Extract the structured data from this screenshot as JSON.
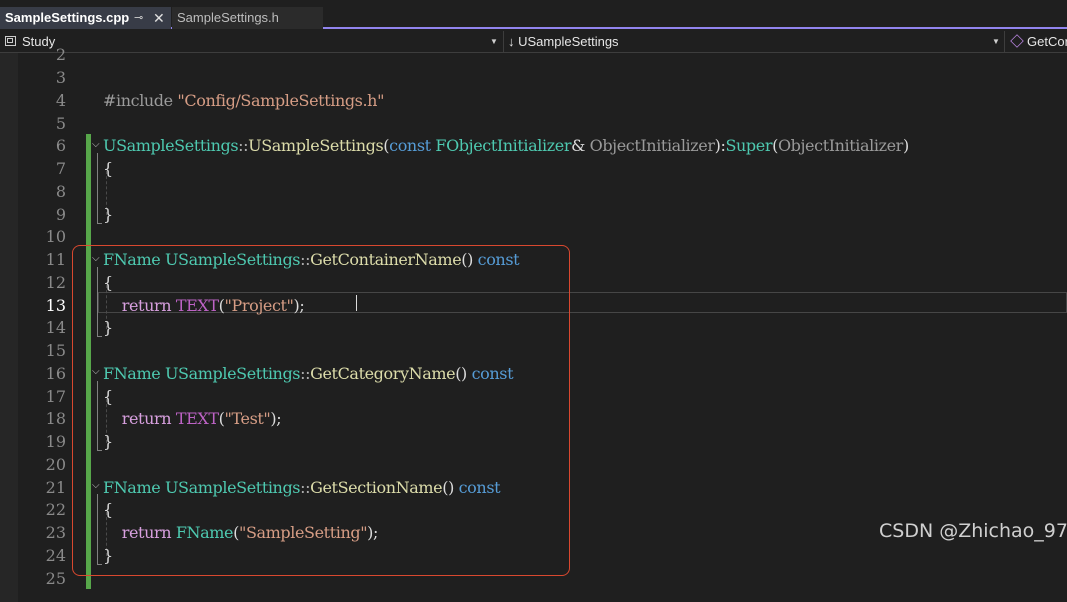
{
  "tabs": [
    {
      "label": "SampleSettings.cpp",
      "active": true
    },
    {
      "label": "SampleSettings.h",
      "active": false
    }
  ],
  "tab_icons": {
    "pin": "⊸",
    "close": "✕"
  },
  "navbar": {
    "project": "Study",
    "class_scope": "↓ USampleSettings",
    "member": "GetCor"
  },
  "editor": {
    "current_line": 13,
    "line_numbers": [
      "2",
      "3",
      "4",
      "5",
      "6",
      "7",
      "8",
      "9",
      "10",
      "11",
      "12",
      "13",
      "14",
      "15",
      "16",
      "17",
      "18",
      "19",
      "20",
      "21",
      "22",
      "23",
      "24",
      "25"
    ],
    "lines": [
      {
        "n": 4,
        "tokens": [
          [
            "pre",
            "#include "
          ],
          [
            "str",
            "\"Config/SampleSettings.h\""
          ]
        ]
      },
      {
        "n": 6,
        "tokens": [
          [
            "type",
            "USampleSettings"
          ],
          [
            "op",
            "::"
          ],
          [
            "ctor",
            "USampleSettings"
          ],
          [
            "txt",
            "("
          ],
          [
            "kw",
            "const "
          ],
          [
            "type",
            "FObjectInitializer"
          ],
          [
            "txt",
            "& "
          ],
          [
            "param",
            "ObjectInitializer"
          ],
          [
            "txt",
            "):"
          ],
          [
            "type",
            "Super"
          ],
          [
            "txt",
            "("
          ],
          [
            "param",
            "ObjectInitializer"
          ],
          [
            "txt",
            ")"
          ]
        ]
      },
      {
        "n": 7,
        "tokens": [
          [
            "txt",
            "{"
          ]
        ]
      },
      {
        "n": 9,
        "tokens": [
          [
            "txt",
            "}"
          ]
        ]
      },
      {
        "n": 11,
        "tokens": [
          [
            "type",
            "FName "
          ],
          [
            "type",
            "USampleSettings"
          ],
          [
            "op",
            "::"
          ],
          [
            "fn",
            "GetContainerName"
          ],
          [
            "txt",
            "() "
          ],
          [
            "kw",
            "const"
          ]
        ]
      },
      {
        "n": 12,
        "tokens": [
          [
            "txt",
            "{"
          ]
        ]
      },
      {
        "n": 13,
        "tokens": [
          [
            "kw-ctrl",
            "    return "
          ],
          [
            "macro",
            "TEXT"
          ],
          [
            "txt",
            "("
          ],
          [
            "str",
            "\"Project\""
          ],
          [
            "txt",
            ");"
          ]
        ]
      },
      {
        "n": 14,
        "tokens": [
          [
            "txt",
            "}"
          ]
        ]
      },
      {
        "n": 16,
        "tokens": [
          [
            "type",
            "FName "
          ],
          [
            "type",
            "USampleSettings"
          ],
          [
            "op",
            "::"
          ],
          [
            "fn",
            "GetCategoryName"
          ],
          [
            "txt",
            "() "
          ],
          [
            "kw",
            "const"
          ]
        ]
      },
      {
        "n": 17,
        "tokens": [
          [
            "txt",
            "{"
          ]
        ]
      },
      {
        "n": 18,
        "tokens": [
          [
            "kw-ctrl",
            "    return "
          ],
          [
            "macro",
            "TEXT"
          ],
          [
            "txt",
            "("
          ],
          [
            "str",
            "\"Test\""
          ],
          [
            "txt",
            ");"
          ]
        ]
      },
      {
        "n": 19,
        "tokens": [
          [
            "txt",
            "}"
          ]
        ]
      },
      {
        "n": 21,
        "tokens": [
          [
            "type",
            "FName "
          ],
          [
            "type",
            "USampleSettings"
          ],
          [
            "op",
            "::"
          ],
          [
            "fn",
            "GetSectionName"
          ],
          [
            "txt",
            "() "
          ],
          [
            "kw",
            "const"
          ]
        ]
      },
      {
        "n": 22,
        "tokens": [
          [
            "txt",
            "{"
          ]
        ]
      },
      {
        "n": 23,
        "tokens": [
          [
            "kw-ctrl",
            "    return "
          ],
          [
            "type",
            "FName"
          ],
          [
            "txt",
            "("
          ],
          [
            "str",
            "\"SampleSetting\""
          ],
          [
            "txt",
            ");"
          ]
        ]
      },
      {
        "n": 24,
        "tokens": [
          [
            "txt",
            "}"
          ]
        ]
      }
    ]
  },
  "watermark": "CSDN @Zhichao_97"
}
